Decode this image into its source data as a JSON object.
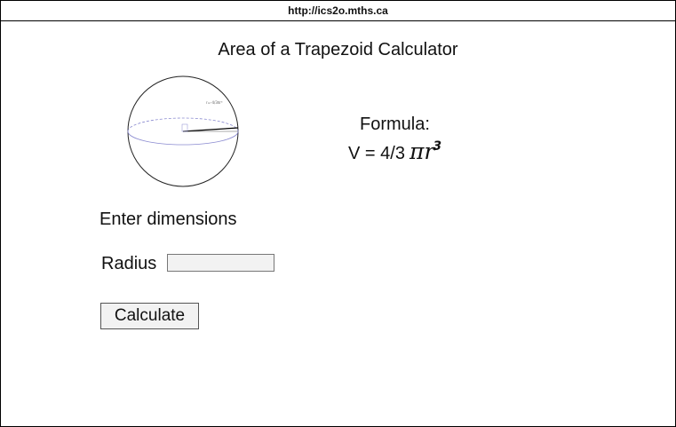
{
  "browser": {
    "url": "http://ics2o.mths.ca"
  },
  "page": {
    "title": "Area of a Trapezoid Calculator",
    "formula_label": "Formula:",
    "formula_prefix": "V = 4/3",
    "formula_pi_r": "πr",
    "formula_exponent": "3",
    "sphere_annotation": "r=-4/3πr³",
    "enter_dimensions": "Enter dimensions",
    "radius_label": "Radius",
    "radius_value": "",
    "calculate_label": "Calculate"
  }
}
